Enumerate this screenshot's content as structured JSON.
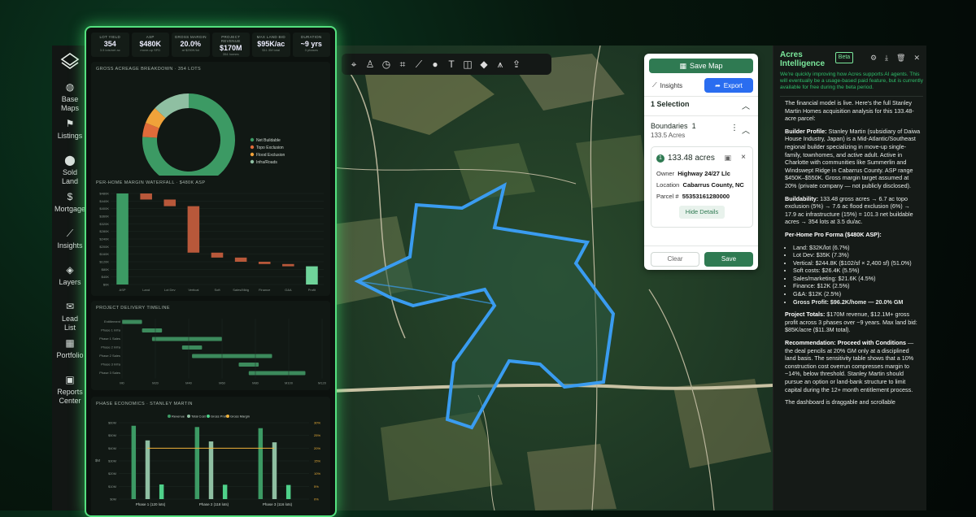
{
  "sidebar": {
    "items": [
      {
        "label1": "Base",
        "label2": "Maps",
        "icon": "globe-icon"
      },
      {
        "label1": "Listings",
        "label2": "",
        "icon": "flag-icon"
      },
      {
        "label1": "Sold",
        "label2": "Land",
        "icon": "pin-icon"
      },
      {
        "label1": "Mortgage",
        "label2": "",
        "icon": "dollar-icon"
      },
      {
        "label1": "Insights",
        "label2": "",
        "icon": "chart-icon"
      },
      {
        "label1": "Layers",
        "label2": "",
        "icon": "layers-icon"
      },
      {
        "label1": "Lead",
        "label2": "List",
        "icon": "mail-icon"
      },
      {
        "label1": "Portfolio",
        "label2": "",
        "icon": "map-icon"
      },
      {
        "label1": "Reports",
        "label2": "Center",
        "icon": "briefcase-icon"
      }
    ]
  },
  "kpis": [
    {
      "label": "LOT YIELD",
      "value": "354",
      "sub": "3.5 lots/net ac"
    },
    {
      "label": "ASP",
      "value": "$480K",
      "sub": "move-up SFD"
    },
    {
      "label": "GROSS MARGIN",
      "value": "20.0%",
      "sub": "at $250K/lot"
    },
    {
      "label": "PROJECT REVENUE",
      "value": "$170M",
      "sub": "354 homes"
    },
    {
      "label": "MAX LAND BID",
      "value": "$95K/ac",
      "sub": "$11.3M total"
    },
    {
      "label": "DURATION",
      "value": "~9 yrs",
      "sub": "3 phases"
    }
  ],
  "donut": {
    "title": "GROSS ACREAGE BREAKDOWN · 354 LOTS",
    "legend": [
      "Net Buildable",
      "Topo Exclusion",
      "Flood Exclusion",
      "Infra/Roads"
    ],
    "colors": [
      "#3c9a64",
      "#e06b3a",
      "#f0a23a",
      "#8fbfa2"
    ]
  },
  "chart_data": [
    {
      "type": "bar",
      "title": "PER-HOME MARGIN WATERFALL · $480K ASP",
      "categories": [
        "ASP",
        "Land",
        "Lot Dev",
        "Vertical",
        "Soft",
        "Sales/Mktg",
        "Finance",
        "G&A",
        "Profit"
      ],
      "values": [
        480,
        -32,
        -35,
        -245,
        -26,
        -22,
        -12,
        -12,
        96
      ],
      "yticks": [
        "$0K",
        "$40K",
        "$80K",
        "$120K",
        "$160K",
        "$200K",
        "$240K",
        "$280K",
        "$320K",
        "$360K",
        "$400K",
        "$440K",
        "$480K"
      ],
      "ylim": [
        0,
        480
      ]
    },
    {
      "type": "bar",
      "title": "PROJECT DELIVERY TIMELINE",
      "categories": [
        "Entitlement",
        "Phase 1 Infra",
        "Phase 1 Sales",
        "Phase 2 Infra",
        "Phase 2 Sales",
        "Phase 3 Infra",
        "Phase 3 Sales"
      ],
      "starts": [
        0,
        12,
        18,
        36,
        42,
        70,
        76
      ],
      "ends": [
        12,
        24,
        60,
        48,
        90,
        82,
        110
      ],
      "xticks": [
        "M0",
        "M20",
        "M40",
        "M60",
        "M80",
        "M100",
        "M120"
      ],
      "xlim": [
        0,
        120
      ]
    },
    {
      "type": "bar",
      "title": "PHASE ECONOMICS · STANLEY MARTIN",
      "categories": [
        "Phase 1 (120 lots)",
        "Phase 2 (118 lots)",
        "Phase 3 (116 lots)"
      ],
      "series": [
        {
          "name": "Revenue",
          "values": [
            57.6,
            56.6,
            55.7
          ]
        },
        {
          "name": "Total Cost",
          "values": [
            46.1,
            45.3,
            44.6
          ]
        },
        {
          "name": "Gross Profit",
          "values": [
            11.5,
            11.3,
            11.1
          ]
        },
        {
          "name": "Gross Margin",
          "values": [
            20,
            20,
            20
          ]
        }
      ],
      "yticks_left": [
        "$0M",
        "$10M",
        "$20M",
        "$30M",
        "$40M",
        "$50M",
        "$60M"
      ],
      "yticks_right": [
        "0%",
        "5%",
        "10%",
        "15%",
        "20%",
        "25%",
        "30%"
      ],
      "ylabel_left": "$M",
      "ylim": [
        0,
        60
      ]
    }
  ],
  "toolbar": {
    "icons": [
      "cursor-icon",
      "person-icon",
      "clock-icon",
      "crop-icon",
      "line-icon",
      "pin-icon",
      "text-icon",
      "shape-icon",
      "ruler-icon",
      "measure-icon",
      "upload-icon"
    ]
  },
  "selection": {
    "save_map": "Save Map",
    "insights": "Insights",
    "export": "Export",
    "title": "1 Selection",
    "boundaries_label": "Boundaries",
    "boundaries_count": "1",
    "boundaries_acres": "133.5 Acres",
    "acres": "133.48 acres",
    "owner_label": "Owner",
    "owner": "Highway 24/27 Llc",
    "location_label": "Location",
    "location": "Cabarrus County, NC",
    "parcel_label": "Parcel #",
    "parcel": "55353161280000",
    "hide_details": "Hide Details",
    "clear": "Clear",
    "save": "Save"
  },
  "ai": {
    "title1": "Acres",
    "title2": "Intelligence",
    "beta": "Beta",
    "note": "We're quickly improving how Acres supports AI agents. This will eventually be a usage-based paid feature, but is currently available for free during the beta period.",
    "intro": "The financial model is live. Here's the full Stanley Martin Homes acquisition analysis for this 133.48-acre parcel:",
    "builder_label": "Builder Profile:",
    "builder": "Stanley Martin (subsidiary of Daiwa House Industry, Japan) is a Mid-Atlantic/Southeast regional builder specializing in move-up single-family, townhomes, and active adult. Active in Charlotte with communities like Summerlin and Windswept Ridge in Cabarrus County. ASP range $450K–$550K. Gross margin target assumed at 20% (private company — not publicly disclosed).",
    "build_label": "Buildability:",
    "build": "133.48 gross acres → 6.7 ac topo exclusion (5%) → 7.6 ac flood exclusion (6%) → 17.9 ac infrastructure (15%) = 101.3 net buildable acres → 354 lots at 3.5 du/ac.",
    "proforma_title": "Per-Home Pro Forma ($480K ASP):",
    "proforma": [
      "Land: $32K/lot (6.7%)",
      "Lot Dev: $35K (7.3%)",
      "Vertical: $244.8K ($102/sf × 2,400 sf) (51.0%)",
      "Soft costs: $26.4K (5.5%)",
      "Sales/marketing: $21.6K (4.5%)",
      "Finance: $12K (2.5%)",
      "G&A: $12K (2.5%)",
      "Gross Profit: $96.2K/home — 20.0% GM"
    ],
    "totals_label": "Project Totals:",
    "totals": "$170M revenue, $12.1M+ gross profit across 3 phases over ~9 years. Max land bid: $85K/acre ($11.3M total).",
    "rec_label": "Recommendation: Proceed with Conditions",
    "rec": "— the deal pencils at 20% GM only at a disciplined land basis. The sensitivity table shows that a 10% construction cost overrun compresses margin to ~14%, below threshold. Stanley Martin should pursue an option or land-bank structure to limit capital during the 12+ month entitlement process.",
    "footer": "The dashboard is draggable and scrollable"
  }
}
